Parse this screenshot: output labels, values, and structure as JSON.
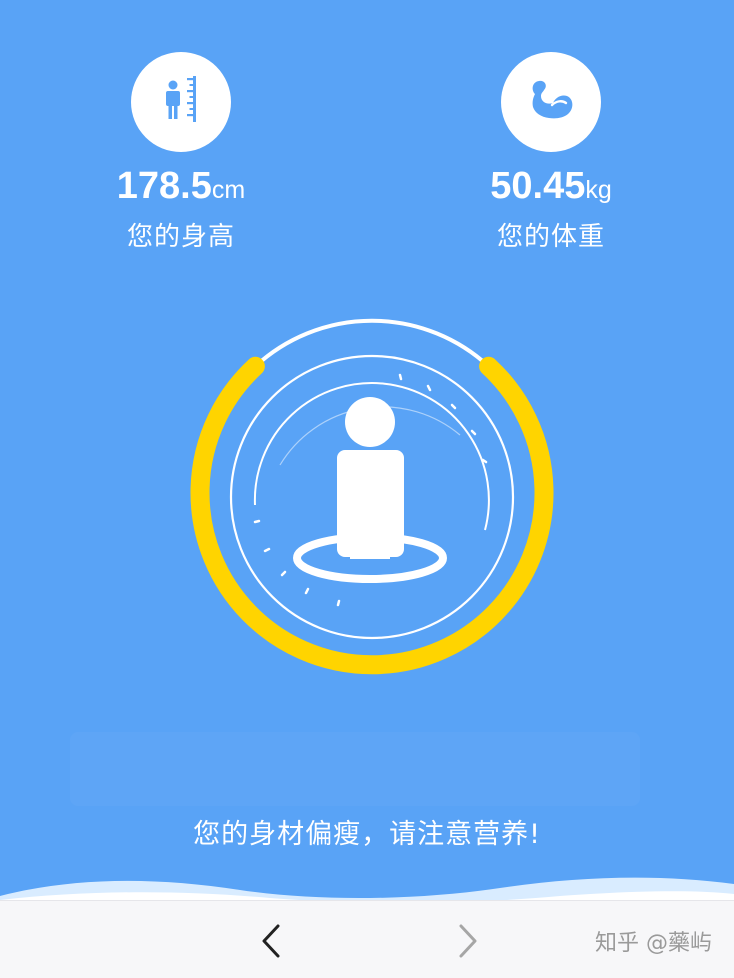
{
  "height_stat": {
    "value": "178.5",
    "unit": "cm",
    "label": "您的身高",
    "icon": "height-ruler-person-icon"
  },
  "weight_stat": {
    "value": "50.45",
    "unit": "kg",
    "label": "您的体重",
    "icon": "flexed-biceps-icon"
  },
  "gauge": {
    "icon": "person-on-platform-icon",
    "accent_color": "#ffd400"
  },
  "message": "您的身材偏瘦，请注意营养!",
  "navbar": {
    "back_icon": "chevron-left-icon",
    "forward_icon": "chevron-right-icon",
    "watermark": "知乎 @藥屿"
  },
  "colors": {
    "background": "#59a3f6",
    "navbar": "#f7f7f9"
  }
}
